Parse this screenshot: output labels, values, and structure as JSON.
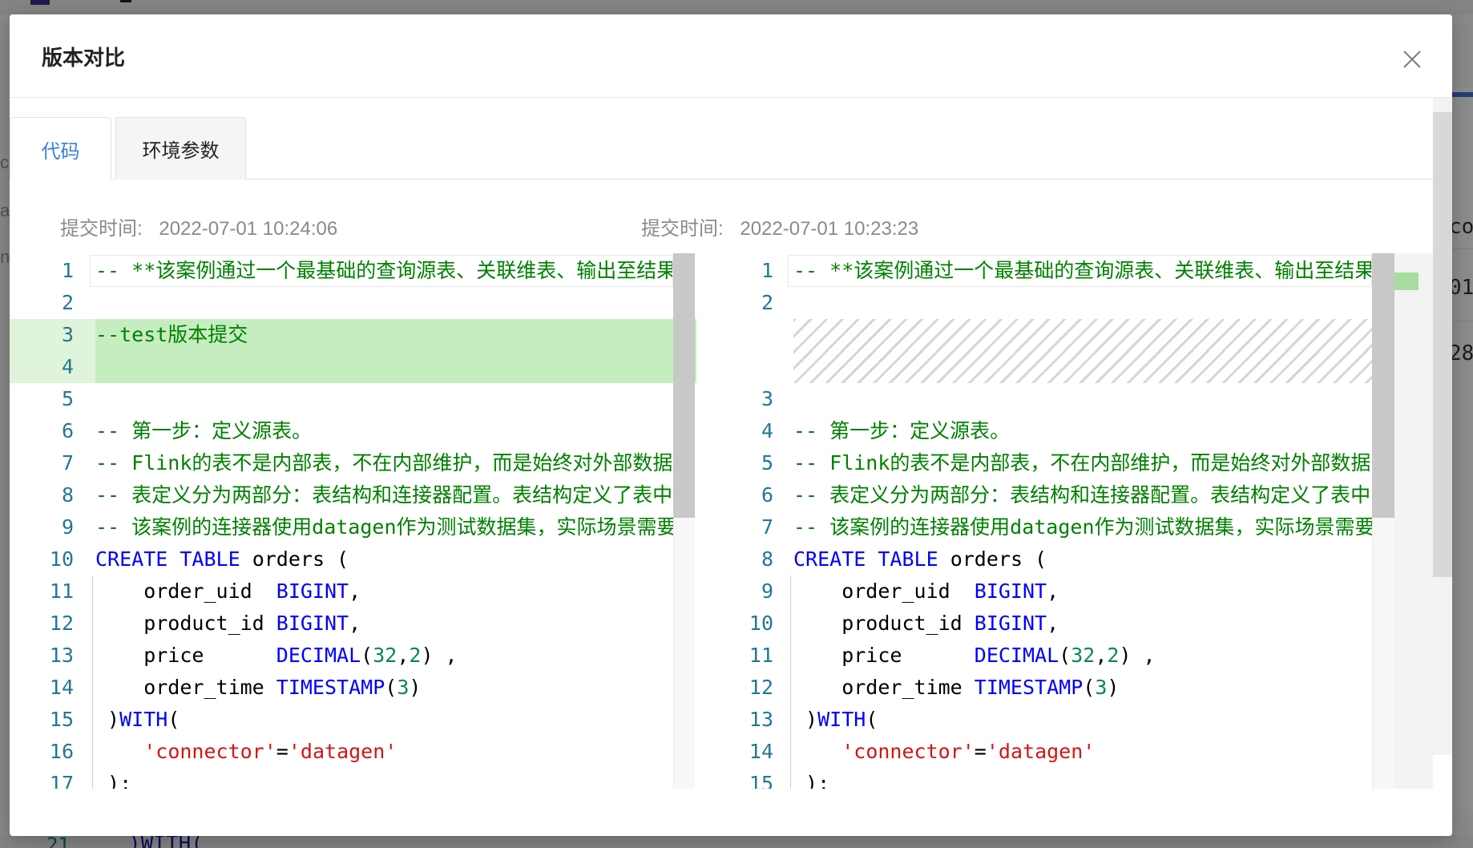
{
  "background": {
    "right_fragments": [
      "con",
      "01",
      "28"
    ],
    "left_fragments": [
      "c",
      "a",
      "n"
    ],
    "bottom_code": ")WITH(",
    "bottom_line_number": "21"
  },
  "modal": {
    "title": "版本对比",
    "close_icon": "close-icon"
  },
  "tabs": [
    {
      "label": "代码",
      "active": true
    },
    {
      "label": "环境参数",
      "active": false
    }
  ],
  "left_pane": {
    "meta_label": "提交时间:",
    "meta_value": "2022-07-01 10:24:06",
    "lines": [
      {
        "n": "1",
        "parts": [
          [
            "cm",
            "-- **该案例通过一个最基础的查询源表、关联维表、输出至结果"
          ]
        ]
      },
      {
        "n": "2",
        "parts": []
      },
      {
        "n": "3",
        "parts": [
          [
            "cm",
            "--test版本提交"
          ]
        ],
        "added": true
      },
      {
        "n": "4",
        "parts": [],
        "added": true
      },
      {
        "n": "5",
        "parts": []
      },
      {
        "n": "6",
        "parts": [
          [
            "cm",
            "-- 第一步：定义源表。"
          ]
        ]
      },
      {
        "n": "7",
        "parts": [
          [
            "cm",
            "-- Flink的表不是内部表，不在内部维护，而是始终对外部数据"
          ]
        ]
      },
      {
        "n": "8",
        "parts": [
          [
            "cm",
            "-- 表定义分为两部分：表结构和连接器配置。表结构定义了表中"
          ]
        ]
      },
      {
        "n": "9",
        "parts": [
          [
            "cm",
            "-- 该案例的连接器使用datagen作为测试数据集，实际场景需要"
          ]
        ]
      },
      {
        "n": "10",
        "parts": [
          [
            "kw",
            "CREATE"
          ],
          [
            "",
            " "
          ],
          [
            "kw",
            "TABLE"
          ],
          [
            "",
            " orders ("
          ]
        ]
      },
      {
        "n": "11",
        "parts": [
          [
            "",
            "    order_uid  "
          ],
          [
            "kw",
            "BIGINT"
          ],
          [
            "",
            ","
          ]
        ]
      },
      {
        "n": "12",
        "parts": [
          [
            "",
            "    product_id "
          ],
          [
            "kw",
            "BIGINT"
          ],
          [
            "",
            ","
          ]
        ]
      },
      {
        "n": "13",
        "parts": [
          [
            "",
            "    price      "
          ],
          [
            "kw",
            "DECIMAL"
          ],
          [
            "",
            "("
          ],
          [
            "num",
            "32"
          ],
          [
            "",
            ","
          ],
          [
            "num",
            "2"
          ],
          [
            "",
            ") ,"
          ]
        ]
      },
      {
        "n": "14",
        "parts": [
          [
            "",
            "    order_time "
          ],
          [
            "kw",
            "TIMESTAMP"
          ],
          [
            "",
            "("
          ],
          [
            "num",
            "3"
          ],
          [
            "",
            ")"
          ]
        ]
      },
      {
        "n": "15",
        "parts": [
          [
            "",
            " )"
          ],
          [
            "kw",
            "WITH"
          ],
          [
            "",
            "("
          ]
        ]
      },
      {
        "n": "16",
        "parts": [
          [
            "",
            "    "
          ],
          [
            "str",
            "'connector'"
          ],
          [
            "",
            "="
          ],
          [
            "str",
            "'datagen'"
          ]
        ]
      },
      {
        "n": "17",
        "parts": [
          [
            "",
            " );"
          ]
        ]
      }
    ]
  },
  "right_pane": {
    "meta_label": "提交时间:",
    "meta_value": "2022-07-01 10:23:23",
    "lines": [
      {
        "n": "1",
        "parts": [
          [
            "cm",
            "-- **该案例通过一个最基础的查询源表、关联维表、输出至结果"
          ]
        ]
      },
      {
        "n": "2",
        "parts": []
      },
      {
        "n": "",
        "parts": [],
        "placeholder": true
      },
      {
        "n": "",
        "parts": [],
        "placeholder": true
      },
      {
        "n": "3",
        "parts": []
      },
      {
        "n": "4",
        "parts": [
          [
            "cm",
            "-- 第一步：定义源表。"
          ]
        ]
      },
      {
        "n": "5",
        "parts": [
          [
            "cm",
            "-- Flink的表不是内部表，不在内部维护，而是始终对外部数据"
          ]
        ]
      },
      {
        "n": "6",
        "parts": [
          [
            "cm",
            "-- 表定义分为两部分：表结构和连接器配置。表结构定义了表中"
          ]
        ]
      },
      {
        "n": "7",
        "parts": [
          [
            "cm",
            "-- 该案例的连接器使用datagen作为测试数据集，实际场景需要"
          ]
        ]
      },
      {
        "n": "8",
        "parts": [
          [
            "kw",
            "CREATE"
          ],
          [
            "",
            " "
          ],
          [
            "kw",
            "TABLE"
          ],
          [
            "",
            " orders ("
          ]
        ]
      },
      {
        "n": "9",
        "parts": [
          [
            "",
            "    order_uid  "
          ],
          [
            "kw",
            "BIGINT"
          ],
          [
            "",
            ","
          ]
        ]
      },
      {
        "n": "10",
        "parts": [
          [
            "",
            "    product_id "
          ],
          [
            "kw",
            "BIGINT"
          ],
          [
            "",
            ","
          ]
        ]
      },
      {
        "n": "11",
        "parts": [
          [
            "",
            "    price      "
          ],
          [
            "kw",
            "DECIMAL"
          ],
          [
            "",
            "("
          ],
          [
            "num",
            "32"
          ],
          [
            "",
            ","
          ],
          [
            "num",
            "2"
          ],
          [
            "",
            ") ,"
          ]
        ]
      },
      {
        "n": "12",
        "parts": [
          [
            "",
            "    order_time "
          ],
          [
            "kw",
            "TIMESTAMP"
          ],
          [
            "",
            "("
          ],
          [
            "num",
            "3"
          ],
          [
            "",
            ")"
          ]
        ]
      },
      {
        "n": "13",
        "parts": [
          [
            "",
            " )"
          ],
          [
            "kw",
            "WITH"
          ],
          [
            "",
            "("
          ]
        ]
      },
      {
        "n": "14",
        "parts": [
          [
            "",
            "    "
          ],
          [
            "str",
            "'connector'"
          ],
          [
            "",
            "="
          ],
          [
            "str",
            "'datagen'"
          ]
        ]
      },
      {
        "n": "15",
        "parts": [
          [
            "",
            " );"
          ]
        ]
      }
    ]
  },
  "colors": {
    "accent": "#3a7ee3",
    "added_line": "#c6edc0",
    "keyword": "#0000ff",
    "comment": "#008000",
    "string": "#d51414",
    "number": "#098658",
    "line_number": "#237893"
  }
}
